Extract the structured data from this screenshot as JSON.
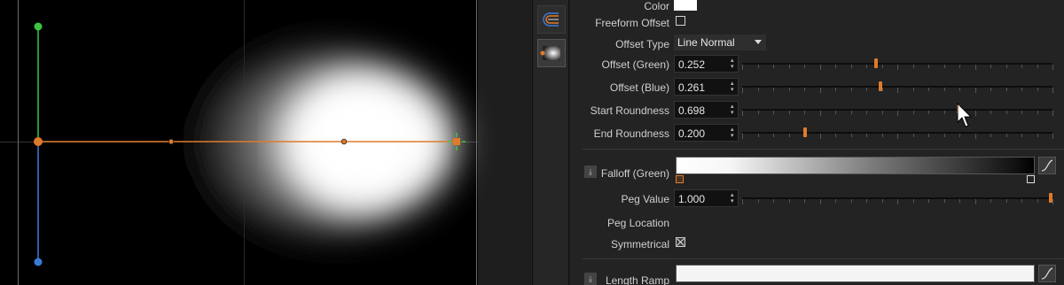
{
  "viewport": {
    "handle_colors": {
      "x_axis": "#e07a2a",
      "y_axis_up": "#3fc23f",
      "y_axis_down": "#3a7bd5",
      "end_handle": "#e07a2a"
    }
  },
  "toolstrip": {
    "tools": [
      {
        "name": "shape-tool-icon"
      },
      {
        "name": "gradient-tool-icon",
        "active": true
      }
    ]
  },
  "properties": {
    "color": {
      "label": "Color",
      "swatch": "#ffffff"
    },
    "freeform_offset": {
      "label": "Freeform Offset",
      "checked": false
    },
    "offset_type": {
      "label": "Offset Type",
      "value": "Line Normal"
    },
    "offset_green": {
      "label": "Offset (Green)",
      "value": "0.252",
      "fraction": 0.43
    },
    "offset_blue": {
      "label": "Offset (Blue)",
      "value": "0.261",
      "fraction": 0.445
    },
    "start_roundness": {
      "label": "Start Roundness",
      "value": "0.698",
      "fraction": 0.698
    },
    "end_roundness": {
      "label": "End Roundness",
      "value": "0.200",
      "fraction": 0.2
    },
    "falloff_green": {
      "label": "Falloff (Green)"
    },
    "peg_value": {
      "label": "Peg Value",
      "value": "1.000",
      "fraction": 1.0
    },
    "peg_location": {
      "label": "Peg Location"
    },
    "symmetrical": {
      "label": "Symmetrical",
      "checked": true
    },
    "length_ramp": {
      "label": "Length Ramp"
    },
    "accent_color": "#e07a2a"
  }
}
